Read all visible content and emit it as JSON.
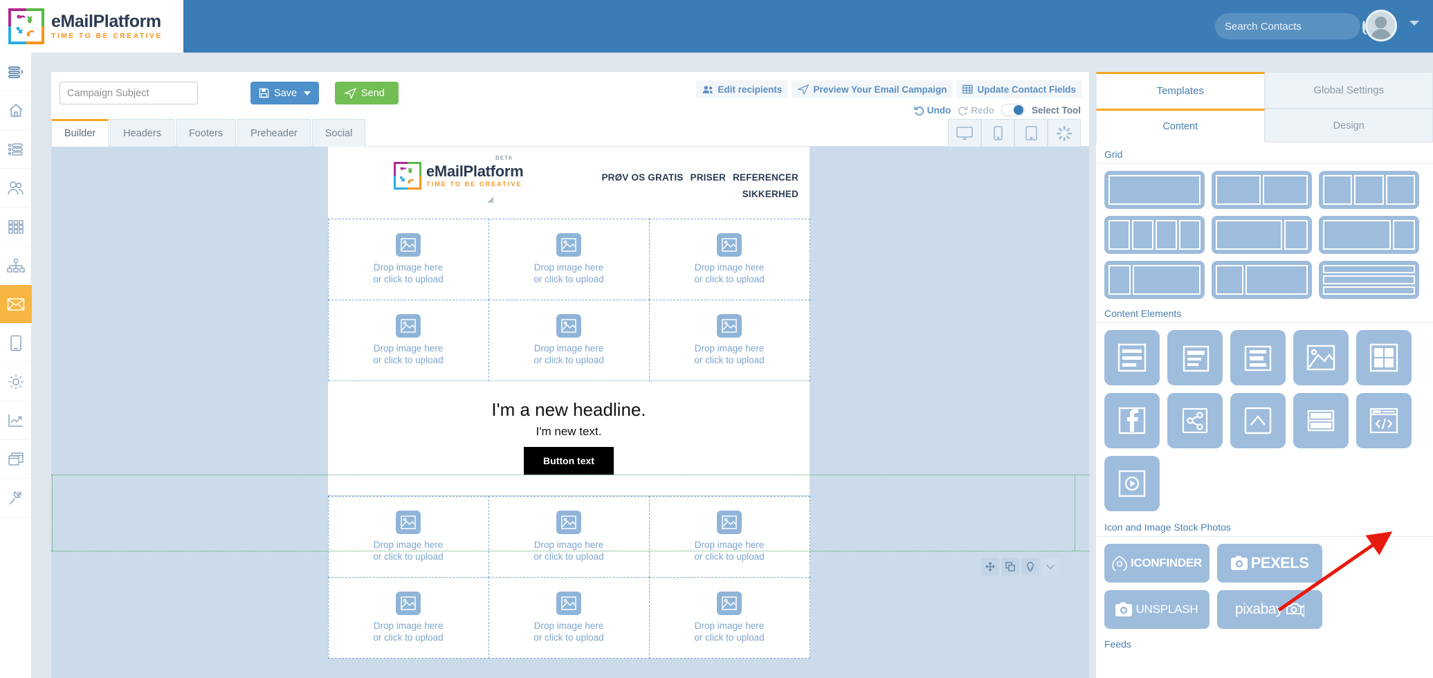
{
  "brand": {
    "name": "eMailPlatform",
    "tagline": "TIME TO BE CREATIVE"
  },
  "topbar": {
    "search_placeholder": "Search Contacts"
  },
  "sidebar": {
    "items": [
      {
        "name": "menu-collapse",
        "icon": "hamburger-icon"
      },
      {
        "name": "home",
        "icon": "home-icon"
      },
      {
        "name": "lists",
        "icon": "list-icon"
      },
      {
        "name": "contacts",
        "icon": "users-icon"
      },
      {
        "name": "apps",
        "icon": "grid-apps-icon"
      },
      {
        "name": "workflows",
        "icon": "sitemap-icon"
      },
      {
        "name": "campaigns",
        "icon": "envelope-icon"
      },
      {
        "name": "mobile",
        "icon": "mobile-icon"
      },
      {
        "name": "settings",
        "icon": "gear-icon"
      },
      {
        "name": "statistics",
        "icon": "chart-line-icon"
      },
      {
        "name": "landing-pages",
        "icon": "windows-icon"
      },
      {
        "name": "integrations",
        "icon": "plug-icon"
      }
    ]
  },
  "toolbar": {
    "subject_placeholder": "Campaign Subject",
    "save_label": "Save",
    "send_label": "Send",
    "links": [
      {
        "label": "Edit recipients",
        "icon": "users-icon"
      },
      {
        "label": "Preview Your Email Campaign",
        "icon": "paper-plane-icon"
      },
      {
        "label": "Update Contact Fields",
        "icon": "table-icon"
      }
    ],
    "undo_label": "Undo",
    "redo_label": "Redo",
    "select_tool_label": "Select Tool",
    "select_tool_on": true
  },
  "tabs": [
    {
      "label": "Builder",
      "active": true
    },
    {
      "label": "Headers",
      "active": false
    },
    {
      "label": "Footers",
      "active": false
    },
    {
      "label": "Preheader",
      "active": false
    },
    {
      "label": "Social",
      "active": false
    }
  ],
  "devices": [
    {
      "name": "desktop-preview",
      "icon": "desktop-icon"
    },
    {
      "name": "mobile-preview",
      "icon": "mobile-icon"
    },
    {
      "name": "tablet-preview",
      "icon": "tablet-icon"
    },
    {
      "name": "loading-preview",
      "icon": "spinner-icon"
    }
  ],
  "email": {
    "beta_label": "BETA",
    "nav": [
      "PRØV OS GRATIS",
      "PRISER",
      "REFERENCER",
      "SIKKERHED"
    ],
    "image_placeholder_line1": "Drop image here",
    "image_placeholder_line2": "or click to upload",
    "headline": "I'm a new headline.",
    "text": "I'm new text.",
    "button_label": "Button text"
  },
  "block_tools": [
    {
      "name": "move-block",
      "icon": "arrows-move-icon"
    },
    {
      "name": "duplicate-block",
      "icon": "copy-icon"
    },
    {
      "name": "block-tips",
      "icon": "lightbulb-icon"
    },
    {
      "name": "move-down-block",
      "icon": "chevron-down-icon"
    }
  ],
  "right_panel": {
    "tabs_top": [
      {
        "label": "Templates",
        "active": true
      },
      {
        "label": "Global Settings",
        "active": false
      }
    ],
    "tabs_sub": [
      {
        "label": "Content",
        "active": true
      },
      {
        "label": "Design",
        "active": false
      }
    ],
    "sections": {
      "grid": "Grid",
      "content_elements": "Content Elements",
      "stock": "Icon and Image Stock Photos",
      "feeds": "Feeds"
    },
    "grid_layouts": [
      {
        "name": "grid-1-column",
        "cols": [
          1
        ]
      },
      {
        "name": "grid-2-column",
        "cols": [
          1,
          1
        ]
      },
      {
        "name": "grid-3-column",
        "cols": [
          1,
          1,
          1
        ]
      },
      {
        "name": "grid-4-column",
        "cols": [
          1,
          1,
          1,
          1
        ]
      },
      {
        "name": "grid-wide-narrow",
        "cols": [
          3,
          1
        ]
      },
      {
        "name": "grid-wide-narrow-2",
        "cols": [
          4,
          1
        ]
      },
      {
        "name": "grid-narrow-wide",
        "cols": [
          1,
          3
        ]
      },
      {
        "name": "grid-narrow-wide-2",
        "cols": [
          1,
          2
        ]
      },
      {
        "name": "grid-three-rows",
        "rows": 3
      }
    ],
    "content_elements": [
      {
        "name": "text-block",
        "icon": "text-lines-icon"
      },
      {
        "name": "text-block-alt",
        "icon": "text-lines-boxed-icon"
      },
      {
        "name": "heading-block",
        "icon": "heading-lines-icon"
      },
      {
        "name": "image-block",
        "icon": "image-icon"
      },
      {
        "name": "gallery-block",
        "icon": "gallery-grid-icon"
      },
      {
        "name": "facebook-block",
        "icon": "facebook-icon"
      },
      {
        "name": "share-block",
        "icon": "share-icon"
      },
      {
        "name": "divider-block",
        "icon": "chevron-up-icon"
      },
      {
        "name": "split-block",
        "icon": "split-rows-icon"
      },
      {
        "name": "html-block",
        "icon": "code-icon"
      },
      {
        "name": "video-block",
        "icon": "play-icon"
      }
    ],
    "stock_sources": [
      {
        "label": "ICONFINDER",
        "icon": "iconfinder-icon"
      },
      {
        "label": "PEXELS",
        "icon": "camera-icon"
      },
      {
        "label": "UNSPLASH",
        "icon": "camera-icon"
      },
      {
        "label": "pixabay",
        "icon": "pixabay-camera-icon"
      }
    ]
  }
}
